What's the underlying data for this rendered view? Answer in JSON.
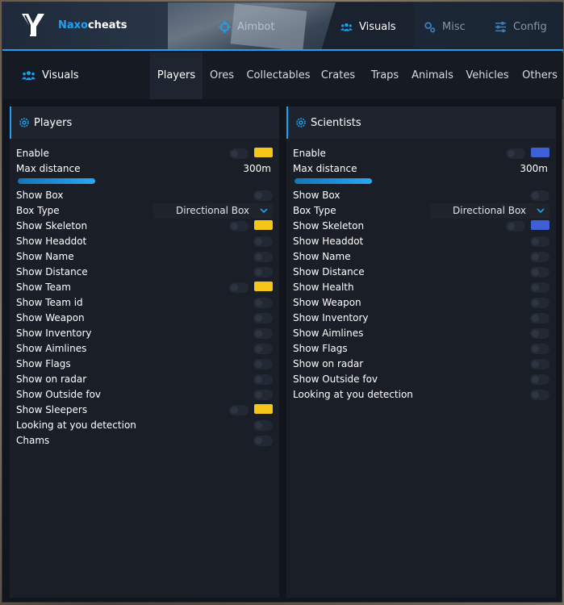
{
  "header": {
    "brand_part1": "Naxo",
    "brand_part2": "cheats",
    "tabs": [
      {
        "label": "Aimbot",
        "icon": "crosshair-icon"
      },
      {
        "label": "Visuals",
        "icon": "users-icon"
      },
      {
        "label": "Misc",
        "icon": "gears-icon"
      },
      {
        "label": "Config",
        "icon": "sliders-icon"
      }
    ],
    "active_tab": "Visuals"
  },
  "subnav": {
    "title": "Visuals",
    "tabs": [
      "Players",
      "Ores",
      "Collectables",
      "Crates",
      "Traps",
      "Animals",
      "Vehicles",
      "Others"
    ],
    "active_tab": "Players"
  },
  "players": {
    "title": "Players",
    "accent": "#f5c518",
    "enable": "Enable",
    "max_distance_label": "Max distance",
    "max_distance_value": "300m",
    "max_distance_fraction": 0.32,
    "show_box": "Show Box",
    "box_type_label": "Box Type",
    "box_type_value": "Directional Box",
    "items": [
      "Show Skeleton",
      "Show Headdot",
      "Show Name",
      "Show Distance",
      "Show Team",
      "Show Team id",
      "Show Weapon",
      "Show Inventory",
      "Show Aimlines",
      "Show Flags",
      "Show on radar",
      "Show Outside fov",
      "Show Sleepers",
      "Looking at you detection",
      "Chams"
    ]
  },
  "scientists": {
    "title": "Scientists",
    "accent": "#3f5fd6",
    "enable": "Enable",
    "max_distance_label": "Max distance",
    "max_distance_value": "300m",
    "max_distance_fraction": 0.32,
    "show_box": "Show Box",
    "box_type_label": "Box Type",
    "box_type_value": "Directional Box",
    "items": [
      "Show Skeleton",
      "Show Headdot",
      "Show Name",
      "Show Distance",
      "Show Health",
      "Show Weapon",
      "Show Inventory",
      "Show Aimlines",
      "Show Flags",
      "Show on radar",
      "Show Outside fov",
      "Looking at you detection"
    ]
  }
}
